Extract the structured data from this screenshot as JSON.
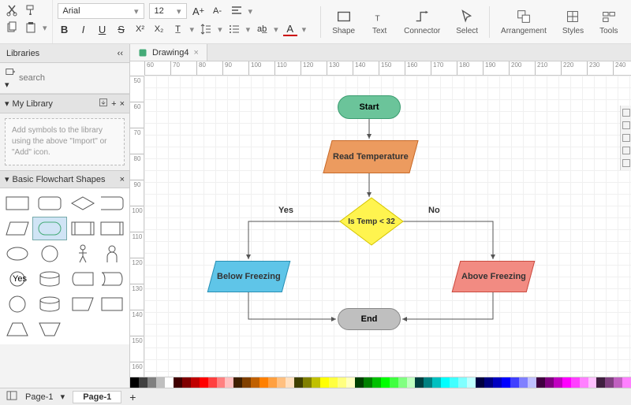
{
  "toolbar": {
    "font": "Arial",
    "font_size": "12",
    "ribbon": {
      "shape": "Shape",
      "text": "Text",
      "connector": "Connector",
      "select": "Select",
      "arrangement": "Arrangement",
      "styles": "Styles",
      "tools": "Tools"
    }
  },
  "sidebar": {
    "libraries_title": "Libraries",
    "search_placeholder": "search",
    "mylib_title": "My Library",
    "hint": "Add symbols to the library using the above \"Import\" or \"Add\" icon.",
    "shapes_title": "Basic Flowchart Shapes",
    "yes_shape_label": "Yes"
  },
  "tabs": {
    "drawing": "Drawing4"
  },
  "ruler": {
    "h": [
      "60",
      "70",
      "80",
      "90",
      "100",
      "110",
      "120",
      "130",
      "140",
      "150",
      "160",
      "170",
      "180",
      "190",
      "200",
      "210",
      "220",
      "230",
      "240"
    ],
    "v": [
      "50",
      "60",
      "70",
      "80",
      "90",
      "100",
      "110",
      "120",
      "130",
      "140",
      "150",
      "160"
    ]
  },
  "flow": {
    "start": "Start",
    "read": "Read Temperature",
    "decision": "Is Temp < 32",
    "yes": "Yes",
    "no": "No",
    "below": "Below Freezing",
    "above": "Above Freezing",
    "end": "End"
  },
  "palette": [
    "#000000",
    "#404040",
    "#808080",
    "#c0c0c0",
    "#ffffff",
    "#400000",
    "#800000",
    "#c00000",
    "#ff0000",
    "#ff4040",
    "#ff8080",
    "#ffc0c0",
    "#402000",
    "#804000",
    "#c06000",
    "#ff8000",
    "#ffa040",
    "#ffc080",
    "#ffe0c0",
    "#404000",
    "#808000",
    "#c0c000",
    "#ffff00",
    "#ffff40",
    "#ffff80",
    "#ffffc0",
    "#004000",
    "#008000",
    "#00c000",
    "#00ff00",
    "#40ff40",
    "#80ff80",
    "#c0ffc0",
    "#004040",
    "#008080",
    "#00c0c0",
    "#00ffff",
    "#40ffff",
    "#80ffff",
    "#c0ffff",
    "#000040",
    "#000080",
    "#0000c0",
    "#0000ff",
    "#4040ff",
    "#8080ff",
    "#c0c0ff",
    "#400040",
    "#800080",
    "#c000c0",
    "#ff00ff",
    "#ff40ff",
    "#ff80ff",
    "#ffc0ff",
    "#402040",
    "#804080",
    "#c060c0",
    "#ff80ff"
  ],
  "status": {
    "page_select": "Page-1",
    "page_tab": "Page-1"
  }
}
